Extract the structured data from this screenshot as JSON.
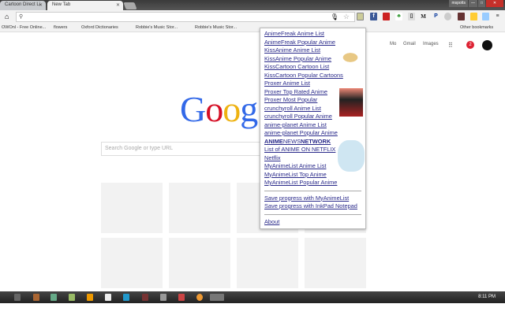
{
  "tabs": [
    {
      "label": "Cartoon Direct Li"
    },
    {
      "label": "New Tab"
    }
  ],
  "window": {
    "profile": "mspotts"
  },
  "bookmarks": [
    "OWOnl - Free Online...",
    "flowers",
    "Oxford Dictionaries",
    "Robbie's Music Stor...",
    "Robbie's Music Stor...",
    "Other bookmarks"
  ],
  "google": {
    "links": [
      "Mo",
      "Gmail",
      "Images"
    ],
    "notifications": "2",
    "logo": "Google",
    "search_placeholder": "Search Google or type URL"
  },
  "popup": {
    "links": [
      "AnimeFreak Anime List",
      "AnimeFreak Popular Anime",
      "KissAnime Anime List",
      "KissAnime Popular Anime",
      "KissCartoon Cartoon List",
      "KissCartoon Popular Cartoons",
      "Proxer Anime List",
      "Proxer Top Rated Anime",
      "Proxer Most Popular",
      "crunchyroll Anime List",
      "crunchyroll Popular Anime",
      "anime-planet Anime List",
      "anime-planet Popular Anime"
    ],
    "ann": {
      "a": "ANIME",
      "b": "NEWS",
      "c": "NETWORK"
    },
    "links2": [
      "List of ANIME ON NETFLIX",
      "Netflix",
      "MyAnimeList Anime List",
      "MyAnimeList Top Anime",
      "MyAnimeList Popular Anime"
    ],
    "save": [
      "Save progress with MyAnimeList",
      "Save progress with InkPad Notepad"
    ],
    "about": "About"
  },
  "taskbar": {
    "clock": "8:11 PM"
  }
}
